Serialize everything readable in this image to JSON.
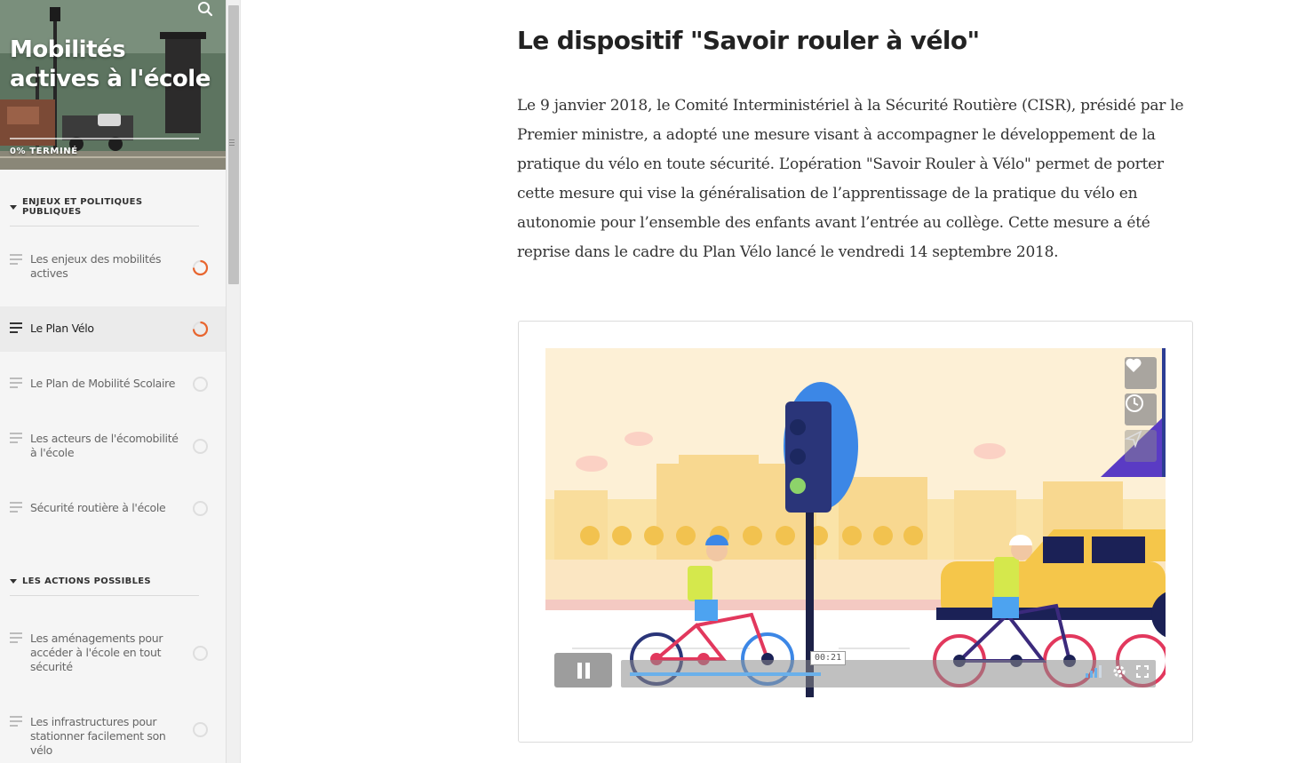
{
  "course": {
    "title": "Mobilités actives à l'école",
    "progress_label": "0% TERMINÉ",
    "progress_fraction": 0
  },
  "sidebar": {
    "sections": [
      {
        "title": "ENJEUX ET POLITIQUES PUBLIQUES",
        "lessons": [
          {
            "label": "Les enjeux des mobilités actives",
            "status": "in-progress"
          },
          {
            "label": "Le Plan Vélo",
            "status": "in-progress",
            "active": true
          },
          {
            "label": "Le Plan de Mobilité Scolaire",
            "status": "not-started"
          },
          {
            "label": "Les acteurs de l'écomobilité à l'école",
            "status": "not-started"
          },
          {
            "label": "Sécurité routière à l'école",
            "status": "not-started"
          }
        ]
      },
      {
        "title": "LES ACTIONS POSSIBLES",
        "lessons": [
          {
            "label": "Les aménagements pour accéder à l'école en tout sécurité",
            "status": "not-started"
          },
          {
            "label": "Les infrastructures pour stationner facilement son vélo",
            "status": "not-started"
          }
        ]
      }
    ]
  },
  "main": {
    "heading": "Le dispositif \"Savoir rouler à vélo\"",
    "paragraph": "Le 9 janvier 2018, le Comité Interministériel à la Sécurité Routière (CISR), présidé par le Premier ministre, a adopté une mesure visant à  accompagner le développement de la pratique du vélo en toute sécurité. L’opération \"Savoir Rouler à Vélo\" permet de porter cette mesure qui vise la généralisation de l’apprentissage de la pratique du vélo en autonomie pour l’ensemble des enfants avant l’entrée au collège. Cette mesure a été reprise dans le cadre du Plan Vélo lancé le vendredi 14 septembre 2018."
  },
  "video": {
    "time_tooltip": "00:21",
    "playback_fraction": 0.37,
    "state": "playing",
    "side_buttons": [
      "heart-icon",
      "clock-icon",
      "send-icon"
    ],
    "colors": {
      "sky": "#fdf0d6",
      "buildings": "#f8d890",
      "accent_orange": "#e8652e",
      "seek_fill": "#6ab0ea"
    }
  },
  "icons": {
    "search": "search-icon",
    "pause": "pause-icon",
    "settings": "gear-icon",
    "fullscreen": "fullscreen-icon",
    "volume": "volume-icon"
  }
}
